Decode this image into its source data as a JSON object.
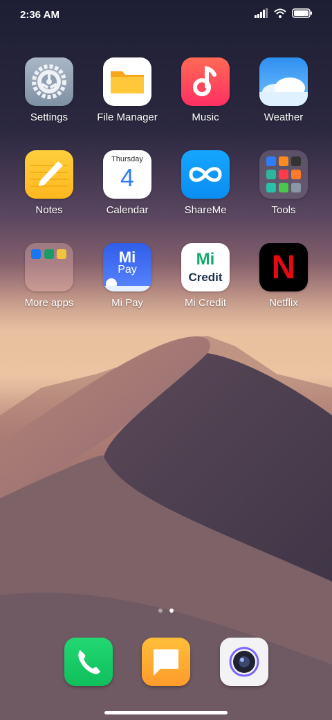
{
  "status": {
    "time": "2:36 AM"
  },
  "apps": {
    "settings": "Settings",
    "file_manager": "File Manager",
    "music": "Music",
    "weather": "Weather",
    "notes": "Notes",
    "calendar": "Calendar",
    "calendar_day": "Thursday",
    "calendar_date": "4",
    "shareme": "ShareMe",
    "tools": "Tools",
    "more_apps": "More apps",
    "mi_pay": "Mi Pay",
    "mi_pay_logo": "Mi",
    "mi_pay_logo2": "Pay",
    "mi_credit": "Mi Credit",
    "mi_credit_logo": "Mi",
    "mi_credit_logo2": "Credit",
    "netflix": "Netflix",
    "netflix_logo": "N"
  },
  "pager": {
    "pages": 2,
    "active": 2
  },
  "dock": [
    "phone-icon",
    "messages-icon",
    "camera-icon"
  ]
}
